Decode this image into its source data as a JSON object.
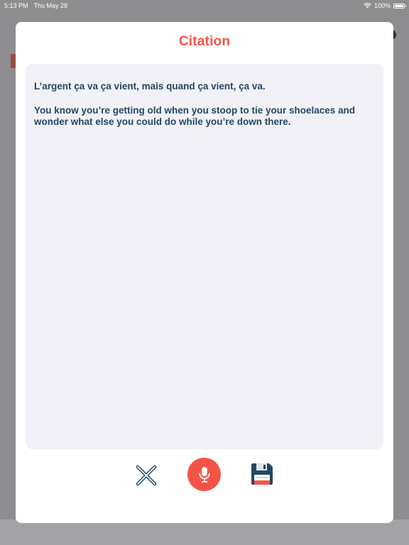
{
  "status_bar": {
    "time": "5:13 PM",
    "date": "Thu May 28",
    "battery": "100%",
    "icons": [
      "wifi-icon",
      "battery-icon"
    ]
  },
  "modal": {
    "title": "Citation",
    "quotes": [
      "L’argent ça va ça vient, mais quand ça vient, ça va.",
      "You know you’re getting old when you stoop to tie your shoelaces and wonder what else you could do while you’re down there."
    ]
  },
  "toolbar": {
    "buttons": [
      {
        "name": "close",
        "icon": "close-icon"
      },
      {
        "name": "microphone",
        "icon": "microphone-icon"
      },
      {
        "name": "save",
        "icon": "floppy-disk-icon"
      }
    ]
  },
  "colors": {
    "accent": "#f45447",
    "text": "#224964",
    "text_area_bg": "#f1f1f7",
    "overlay": "#8e8e90"
  }
}
